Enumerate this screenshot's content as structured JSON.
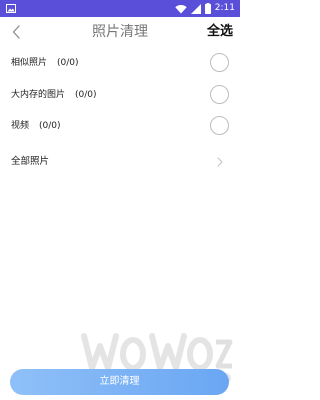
{
  "status_bar": {
    "time": "2:11",
    "icons": [
      "image-icon",
      "wifi-icon",
      "signal-icon",
      "battery-icon"
    ]
  },
  "header": {
    "back_icon": "chevron-left-icon",
    "title": "照片清理",
    "select_all_label": "全选"
  },
  "options": [
    {
      "label": "相似照片",
      "count": "(0/0)",
      "checked": false
    },
    {
      "label": "大内存的图片",
      "count": "(0/0)",
      "checked": false
    },
    {
      "label": "视频",
      "count": "(0/0)",
      "checked": false
    }
  ],
  "all_photos": {
    "label": "全部照片",
    "icon": "chevron-right-icon"
  },
  "clean_button": {
    "label": "立即清理"
  },
  "colors": {
    "status_bar": "#5a4fd8",
    "button_start": "#8fc0f8",
    "button_end": "#6aa6f3",
    "radio_border": "#bdbdbd"
  }
}
